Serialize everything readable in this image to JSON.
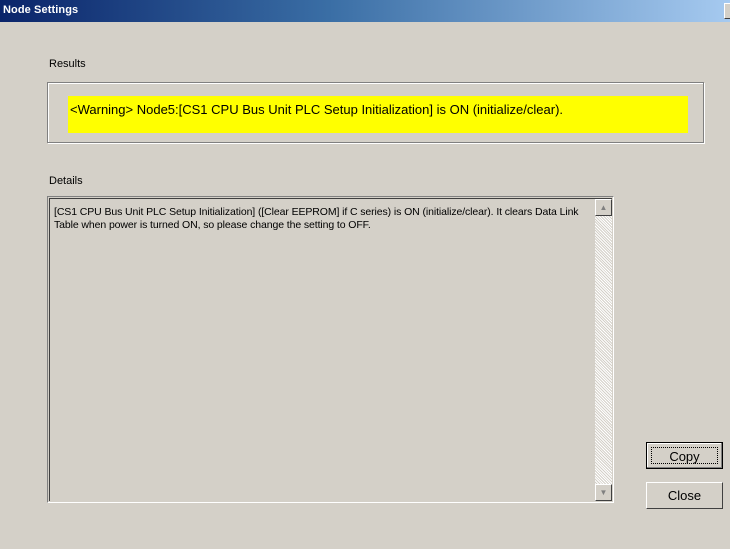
{
  "window": {
    "title": "Node Settings",
    "close_glyph": "x"
  },
  "results": {
    "label": "Results",
    "message": "<Warning> Node5:[CS1 CPU Bus Unit PLC Setup Initialization] is ON (initialize/clear).",
    "highlight_color": "#ffff00"
  },
  "details": {
    "label": "Details",
    "text": "[CS1 CPU Bus Unit PLC Setup Initialization] ([Clear EEPROM] if C series) is ON (initialize/clear).  It clears Data Link Table when power is turned ON, so please change the setting to OFF.",
    "scroll_up_icon": "scroll-up-arrow",
    "scroll_down_icon": "scroll-down-arrow"
  },
  "buttons": {
    "copy": "Copy",
    "close": "Close"
  }
}
